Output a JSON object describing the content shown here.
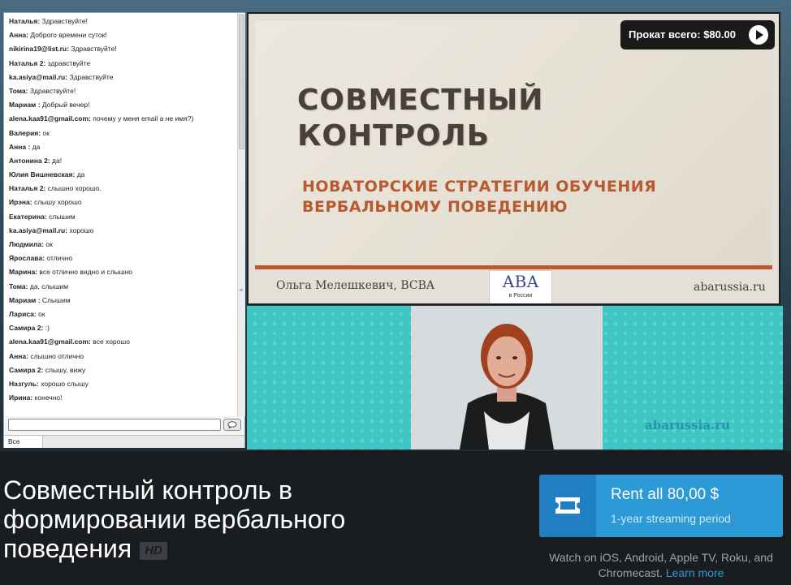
{
  "chat": {
    "messages": [
      {
        "user": "Наталья:",
        "text": "Здравствуйте!"
      },
      {
        "user": "Анна:",
        "text": "Доброго времени суток!"
      },
      {
        "user": "nikirina19@list.ru:",
        "text": "Здравствуйте!"
      },
      {
        "user": "Наталья 2:",
        "text": "здравствуйте"
      },
      {
        "user": "ka.asiya@mail.ru:",
        "text": "Здравствуйте"
      },
      {
        "user": "Тома:",
        "text": "Здравствуйте!"
      },
      {
        "user": "Мариам :",
        "text": "Добрый вечер!"
      },
      {
        "user": "alena.kaa91@gmail.com:",
        "text": "почему у меня email а не имя?)"
      },
      {
        "user": "Валерия:",
        "text": "ок"
      },
      {
        "user": "Анна :",
        "text": "да"
      },
      {
        "user": "Антонина 2:",
        "text": "да!"
      },
      {
        "user": "Юлия Вишневская:",
        "text": "да"
      },
      {
        "user": "Наталья 2:",
        "text": "слышно хорошо."
      },
      {
        "user": "Ирэна:",
        "text": "слышу хорошо"
      },
      {
        "user": "Екатерина:",
        "text": "слышим"
      },
      {
        "user": "ka.asiya@mail.ru:",
        "text": "хорошо"
      },
      {
        "user": "Людмила:",
        "text": "ок"
      },
      {
        "user": "Ярославa:",
        "text": "отлично"
      },
      {
        "user": "Марина:",
        "text": "все отлично видно и слышно"
      },
      {
        "user": "Тома:",
        "text": "да, слышим"
      },
      {
        "user": "Мариам :",
        "text": "Слышим"
      },
      {
        "user": "Лариса:",
        "text": "ок"
      },
      {
        "user": "Самира 2:",
        "text": ":)"
      },
      {
        "user": "alena.kaa91@gmail.com:",
        "text": "все хорошо"
      },
      {
        "user": "Анна:",
        "text": "слышно отлично"
      },
      {
        "user": "Самира 2:",
        "text": "слышу, вижу"
      },
      {
        "user": "Назгуль:",
        "text": "хорошо слышу"
      },
      {
        "user": "Ирина:",
        "text": "конечно!"
      }
    ],
    "tab_all": "Все",
    "scroll_grip": "≡"
  },
  "slide": {
    "title_line1": "СОВМЕСТНЫЙ",
    "title_line2": "КОНТРОЛЬ",
    "subtitle_line1": "НОВАТОРСКИЕ СТРАТЕГИИ ОБУЧЕНИЯ",
    "subtitle_line2": "ВЕРБАЛЬНОМУ ПОВЕДЕНИЮ",
    "author": "Ольга Мелешкевич, BCBA",
    "logo_main": "АВА",
    "logo_sub": "в России",
    "site": "abarussia.ru"
  },
  "rent_badge": {
    "label": "Прокат всего: $80.00",
    "icon": "play-icon"
  },
  "cam": {
    "site": "abarussia.ru"
  },
  "video": {
    "title": "Совместный контроль в формировании вербального поведения",
    "hd": "HD"
  },
  "rent_button": {
    "label": "Rent all 80,00 $",
    "sub": "1-year streaming period",
    "icon": "ticket-icon"
  },
  "watch_note": {
    "text": "Watch on iOS, Android, Apple TV, Roku, and Chromecast.",
    "link": "Learn more"
  },
  "colors": {
    "accent": "#2d9ad8",
    "slide_accent": "#b85a30",
    "cam_bg": "#3fc6c2"
  }
}
